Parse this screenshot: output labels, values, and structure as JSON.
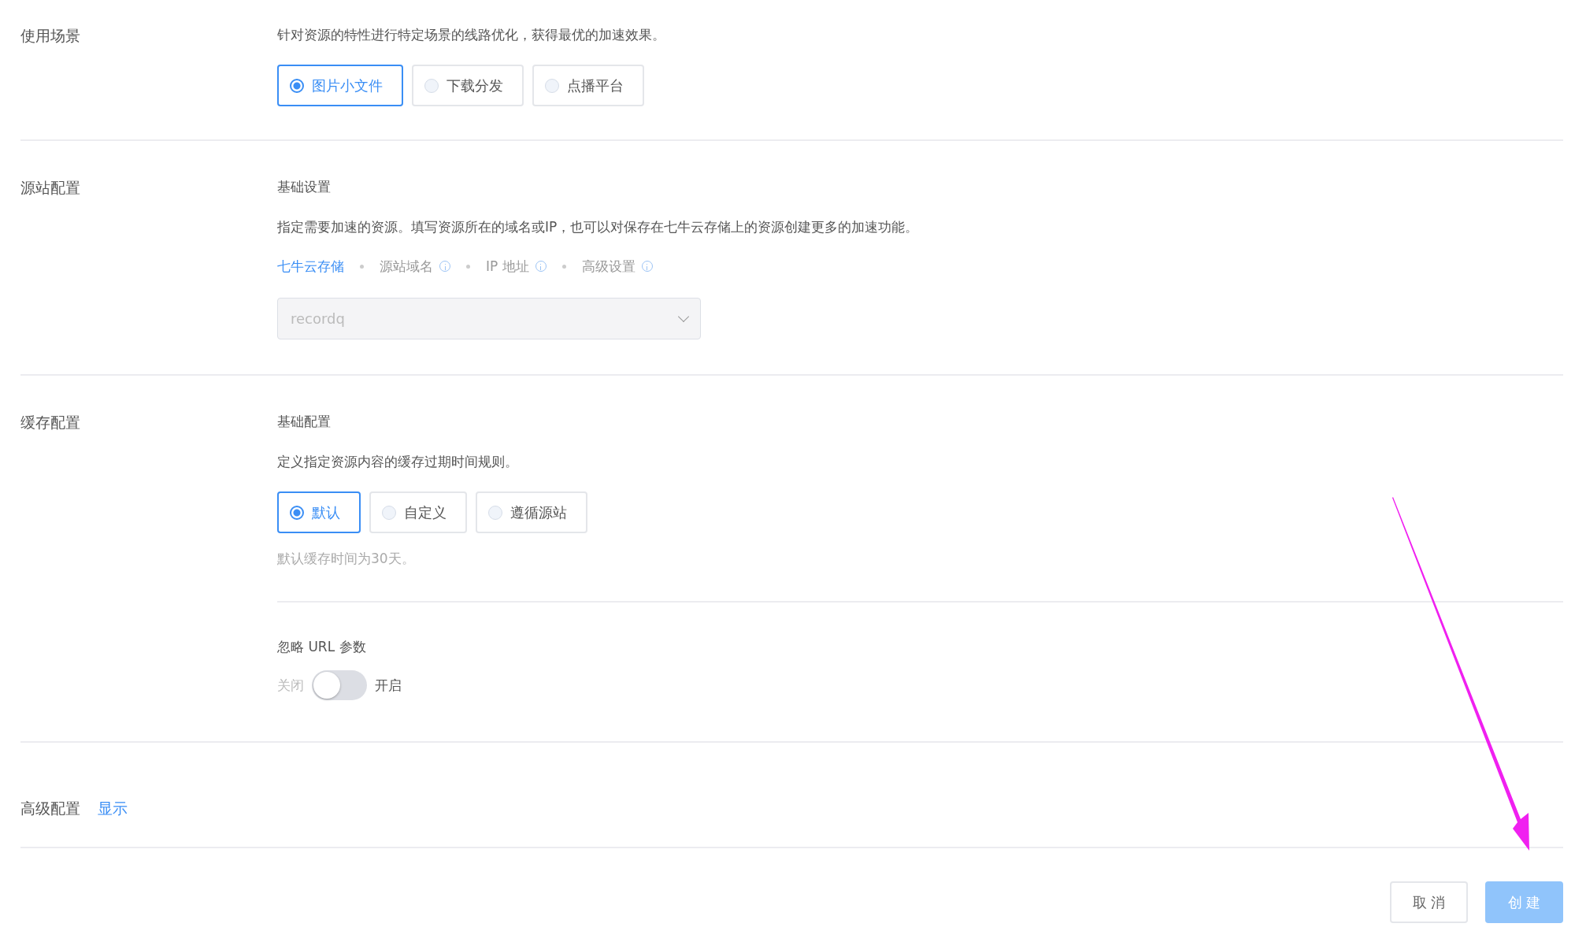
{
  "sections": [
    {
      "kind": "scene",
      "label": "使用场景",
      "description": "针对资源的特性进行特定场景的线路优化，获得最优的加速效果。",
      "options": [
        {
          "label": "图片小文件",
          "selected": true
        },
        {
          "label": "下载分发",
          "selected": false
        },
        {
          "label": "点播平台",
          "selected": false
        }
      ]
    },
    {
      "kind": "origin",
      "label": "源站配置",
      "subtitle": "基础设置",
      "description": "指定需要加速的资源。填写资源所在的域名或IP，也可以对保存在七牛云存储上的资源创建更多的加速功能。",
      "tabs": [
        {
          "label": "七牛云存储",
          "selected": true,
          "info": false
        },
        {
          "label": "源站域名",
          "selected": false,
          "info": true
        },
        {
          "label": "IP 地址",
          "selected": false,
          "info": true
        },
        {
          "label": "高级设置",
          "selected": false,
          "info": true
        }
      ],
      "select": {
        "value": "recordq",
        "disabled": true
      }
    },
    {
      "kind": "cache",
      "label": "缓存配置",
      "subtitle": "基础配置",
      "description": "定义指定资源内容的缓存过期时间规则。",
      "options": [
        {
          "label": "默认",
          "selected": true
        },
        {
          "label": "自定义",
          "selected": false
        },
        {
          "label": "遵循源站",
          "selected": false
        }
      ],
      "hint": "默认缓存时间为30天。",
      "ignore_params": {
        "title": "忽略 URL 参数",
        "off_label": "关闭",
        "on_label": "开启",
        "on": false
      }
    },
    {
      "kind": "advanced",
      "label": "高级配置",
      "link": "显示"
    }
  ],
  "buttons": [
    {
      "label": "取 消",
      "kind": "default",
      "disabled": false
    },
    {
      "label": "创 建",
      "kind": "primary",
      "disabled": true
    }
  ]
}
